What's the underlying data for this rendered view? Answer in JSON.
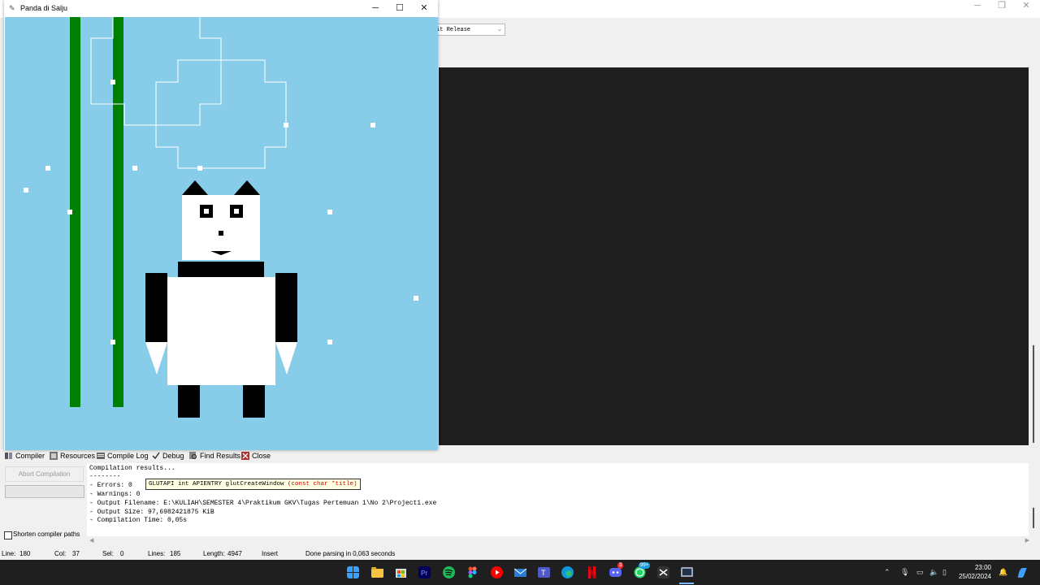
{
  "glut_window": {
    "title": "Panda di Salju",
    "canvas_background": "#87cdea",
    "controls": {
      "minimize": "─",
      "maximize": "☐",
      "close": "✕"
    }
  },
  "ide": {
    "config_select_value": "it Release",
    "tabs": [
      {
        "label": "Compiler",
        "icon": "compiler-icon"
      },
      {
        "label": "Resources",
        "icon": "resources-icon"
      },
      {
        "label": "Compile Log",
        "icon": "compile-log-icon"
      },
      {
        "label": "Debug",
        "icon": "debug-check-icon"
      },
      {
        "label": "Find Results",
        "icon": "find-results-icon"
      },
      {
        "label": "Close",
        "icon": "close-tab-icon"
      }
    ],
    "abort_button": "Abort Compilation",
    "shorten_paths_label": "Shorten compiler paths",
    "log_lines": [
      "Compilation results...",
      "--------",
      "- Errors: 0",
      "- Warnings: 0",
      "- Output Filename: E:\\KULIAH\\SEMESTER 4\\Praktikum GKV\\Tugas Pertemuan 1\\No 2\\Project1.exe",
      "- Output Size: 97,6982421875 KiB",
      "- Compilation Time: 0,05s"
    ],
    "tooltip": {
      "prefix": "GLUTAPI int APIENTRY glutCreateWindow ",
      "params": "(const char *title)"
    },
    "status": {
      "line_label": "Line:",
      "line": "180",
      "col_label": "Col:",
      "col": "37",
      "sel_label": "Sel:",
      "sel": "0",
      "lines_label": "Lines:",
      "lines": "185",
      "length_label": "Length:",
      "length": "4947",
      "mode": "Insert",
      "message": "Done parsing in 0,063 seconds"
    }
  },
  "taskbar": {
    "clock_time": "23:00",
    "clock_date": "25/02/2024",
    "badges": {
      "discord": "3",
      "whatsapp": "99+"
    },
    "apps": [
      "windows-start-icon",
      "file-explorer-icon",
      "store-icon",
      "premiere-icon",
      "spotify-icon",
      "figma-icon",
      "youtube-icon",
      "mail-icon",
      "teams-icon",
      "edge-icon",
      "netflix-icon",
      "discord-icon",
      "whatsapp-icon",
      "capcut-icon",
      "devcpp-icon"
    ]
  }
}
